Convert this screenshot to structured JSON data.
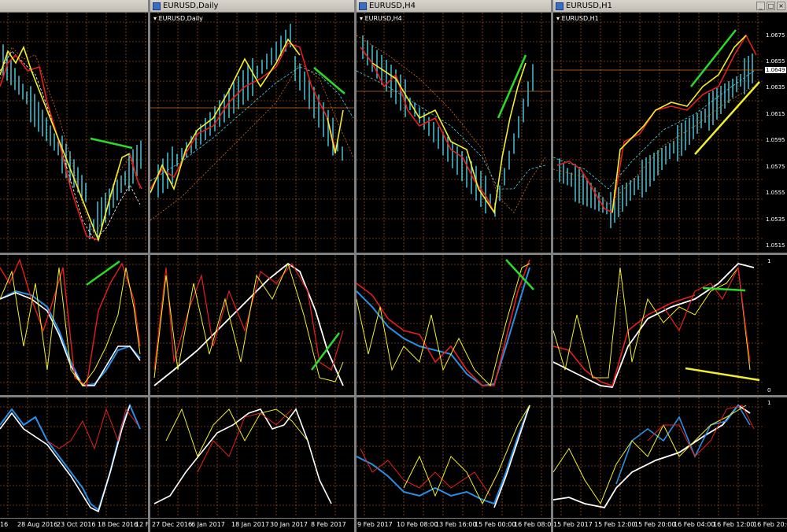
{
  "colors": {
    "grid": "#c8641e",
    "red": "#e61e1e",
    "yellow": "#f0f02a",
    "white": "#ffffff",
    "blue": "#2890e6",
    "green": "#28dc28",
    "cyan": "#4ad2e6",
    "orange": "#d26a1e"
  },
  "windows": [
    {
      "title": "",
      "symbol": "",
      "xlabels": [
        "16",
        "28 Aug 2016",
        "23 Oct 2016",
        "18 Dec 2016",
        "12 F"
      ],
      "scale": []
    },
    {
      "title": "EURUSD,Daily",
      "symbol": "EURUSD,Daily",
      "xlabels": [
        "27 Dec 2016",
        "6 Jan 2017",
        "18 Jan 2017",
        "30 Jan 2017",
        "8 Feb 2017"
      ],
      "scale": []
    },
    {
      "title": "EURUSD,H4",
      "symbol": "EURUSD,H4",
      "xlabels": [
        "9 Feb 2017",
        "10 Feb 08:00",
        "13 Feb 16:00",
        "15 Feb 00:00",
        "16 Feb 08:00"
      ],
      "scale": []
    },
    {
      "title": "EURUSD,H1",
      "symbol": "EURUSD,H1",
      "xlabels": [
        "15 Feb 2017",
        "15 Feb 12:00",
        "15 Feb 20:00",
        "16 Feb 04:00",
        "16 Feb 12:00",
        "16 Feb 20:00"
      ],
      "scale": [
        "1.0675",
        "1.0655",
        "1.0649",
        "1.0635",
        "1.0615",
        "1.0595",
        "1.0575",
        "1.0555",
        "1.0535",
        "1.0515"
      ],
      "osc_scale": [
        "1",
        "0",
        "1"
      ]
    }
  ],
  "icons": {
    "window": "chart-window-icon",
    "minimize": "minimize-icon",
    "maximize": "maximize-icon",
    "close": "close-icon",
    "dropdown": "dropdown-arrow-icon"
  }
}
